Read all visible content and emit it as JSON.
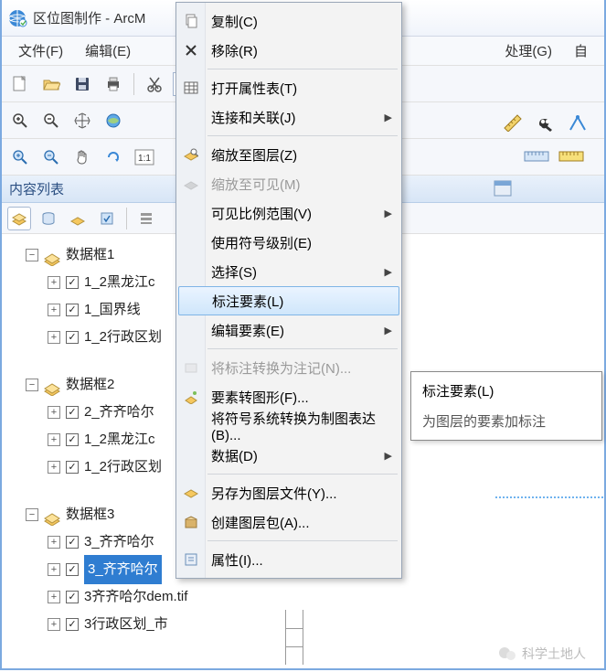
{
  "title": "区位图制作 - ArcM",
  "menubar": {
    "file": "文件(F)",
    "edit": "编辑(E)",
    "geoproc": "处理(G)",
    "custom": "自"
  },
  "panel": {
    "header": "内容列表"
  },
  "tree": {
    "df1": {
      "name": "数据框1",
      "layers": [
        "1_2黑龙江c",
        "1_国界线",
        "1_2行政区划"
      ]
    },
    "df2": {
      "name": "数据框2",
      "layers": [
        "2_齐齐哈尔",
        "1_2黑龙江c",
        "1_2行政区划"
      ]
    },
    "df3": {
      "name": "数据框3",
      "layers": [
        "3_齐齐哈尔",
        "3_齐齐哈尔",
        "3齐齐哈尔dem.tif",
        "3行政区划_市"
      ]
    }
  },
  "ctx": {
    "copy": "复制(C)",
    "remove": "移除(R)",
    "openattr": "打开属性表(T)",
    "joinrelate": "连接和关联(J)",
    "zoomlayer": "缩放至图层(Z)",
    "zoomvisible": "缩放至可见(M)",
    "visiblescale": "可见比例范围(V)",
    "usesymbol": "使用符号级别(E)",
    "selection": "选择(S)",
    "labelfeat": "标注要素(L)",
    "editfeat": "编辑要素(E)",
    "labeltoanno": "将标注转换为注记(N)...",
    "feat2graphic": "要素转图形(F)...",
    "sym2rep": "将符号系统转换为制图表达(B)...",
    "data": "数据(D)",
    "savelayer": "另存为图层文件(Y)...",
    "createpkg": "创建图层包(A)...",
    "props": "属性(I)..."
  },
  "tooltip": {
    "title": "标注要素(L)",
    "body": "为图层的要素加标注"
  },
  "watermark": "科学土地人"
}
